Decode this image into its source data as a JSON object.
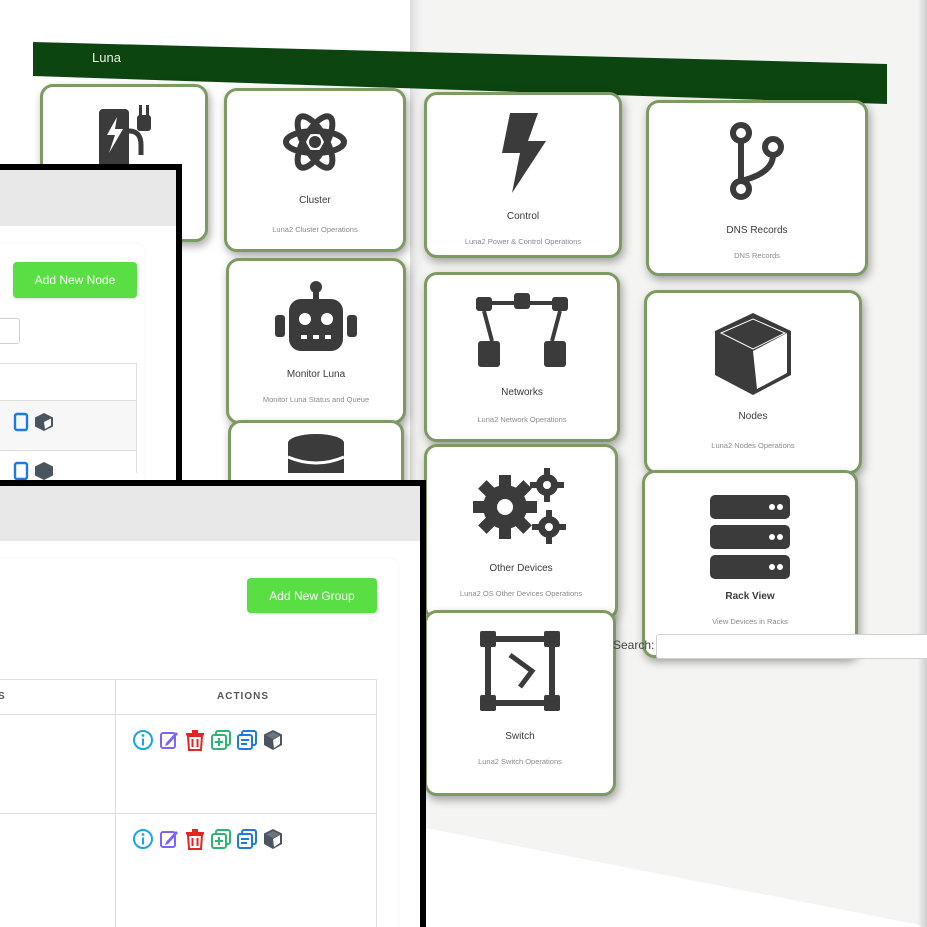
{
  "dashboard": {
    "title": "Luna",
    "tiles": [
      {
        "id": "power",
        "title": "",
        "subtitle": "",
        "icon": "power-plug-icon"
      },
      {
        "id": "cluster",
        "title": "Cluster",
        "subtitle": "Luna2 Cluster Operations",
        "icon": "atom-icon"
      },
      {
        "id": "control",
        "title": "Control",
        "subtitle": "Luna2 Power & Control Operations",
        "icon": "bolt-icon"
      },
      {
        "id": "dns",
        "title": "DNS Records",
        "subtitle": "DNS Records",
        "icon": "code-branch-icon"
      },
      {
        "id": "monitor",
        "title": "Monitor Luna",
        "subtitle": "Monitor Luna Status and Queue",
        "icon": "robot-icon"
      },
      {
        "id": "networks",
        "title": "Networks",
        "subtitle": "Luna2 Network Operations",
        "icon": "network-icon"
      },
      {
        "id": "nodes",
        "title": "Nodes",
        "subtitle": "Luna2 Nodes Operations",
        "icon": "cube-icon"
      },
      {
        "id": "database",
        "title": "",
        "subtitle": "",
        "icon": "database-icon"
      },
      {
        "id": "other",
        "title": "Other Devices",
        "subtitle": "Luna2 OS Other Devices Operations",
        "icon": "gears-icon"
      },
      {
        "id": "rack",
        "title": "Rack View",
        "subtitle": "View Devices in Racks",
        "icon": "server-icon"
      },
      {
        "id": "switch",
        "title": "Switch",
        "subtitle": "Luna2 Switch Operations",
        "icon": "vector-square-icon"
      }
    ]
  },
  "nodes_window": {
    "add_button": "Add New Node"
  },
  "groups_window": {
    "add_button": "Add New Group",
    "search_label": "Search:",
    "search_value": "",
    "col_partial": "S",
    "col_actions": "ACTIONS",
    "rows": [
      {
        "actions": [
          "info",
          "edit",
          "delete",
          "clone",
          "rename",
          "osimage"
        ]
      },
      {
        "actions": [
          "info",
          "edit",
          "delete",
          "clone",
          "rename",
          "osimage"
        ]
      }
    ]
  },
  "colors": {
    "luna_bar": "#0d4511",
    "tile_border": "#7c9a62",
    "button_green": "#59de43",
    "icon_info": "#1aa3e8",
    "icon_edit": "#7a63ff",
    "icon_delete": "#e62222",
    "icon_clone": "#2bb673",
    "icon_rename": "#1f7ae0",
    "icon_osimage": "#4a5560"
  }
}
